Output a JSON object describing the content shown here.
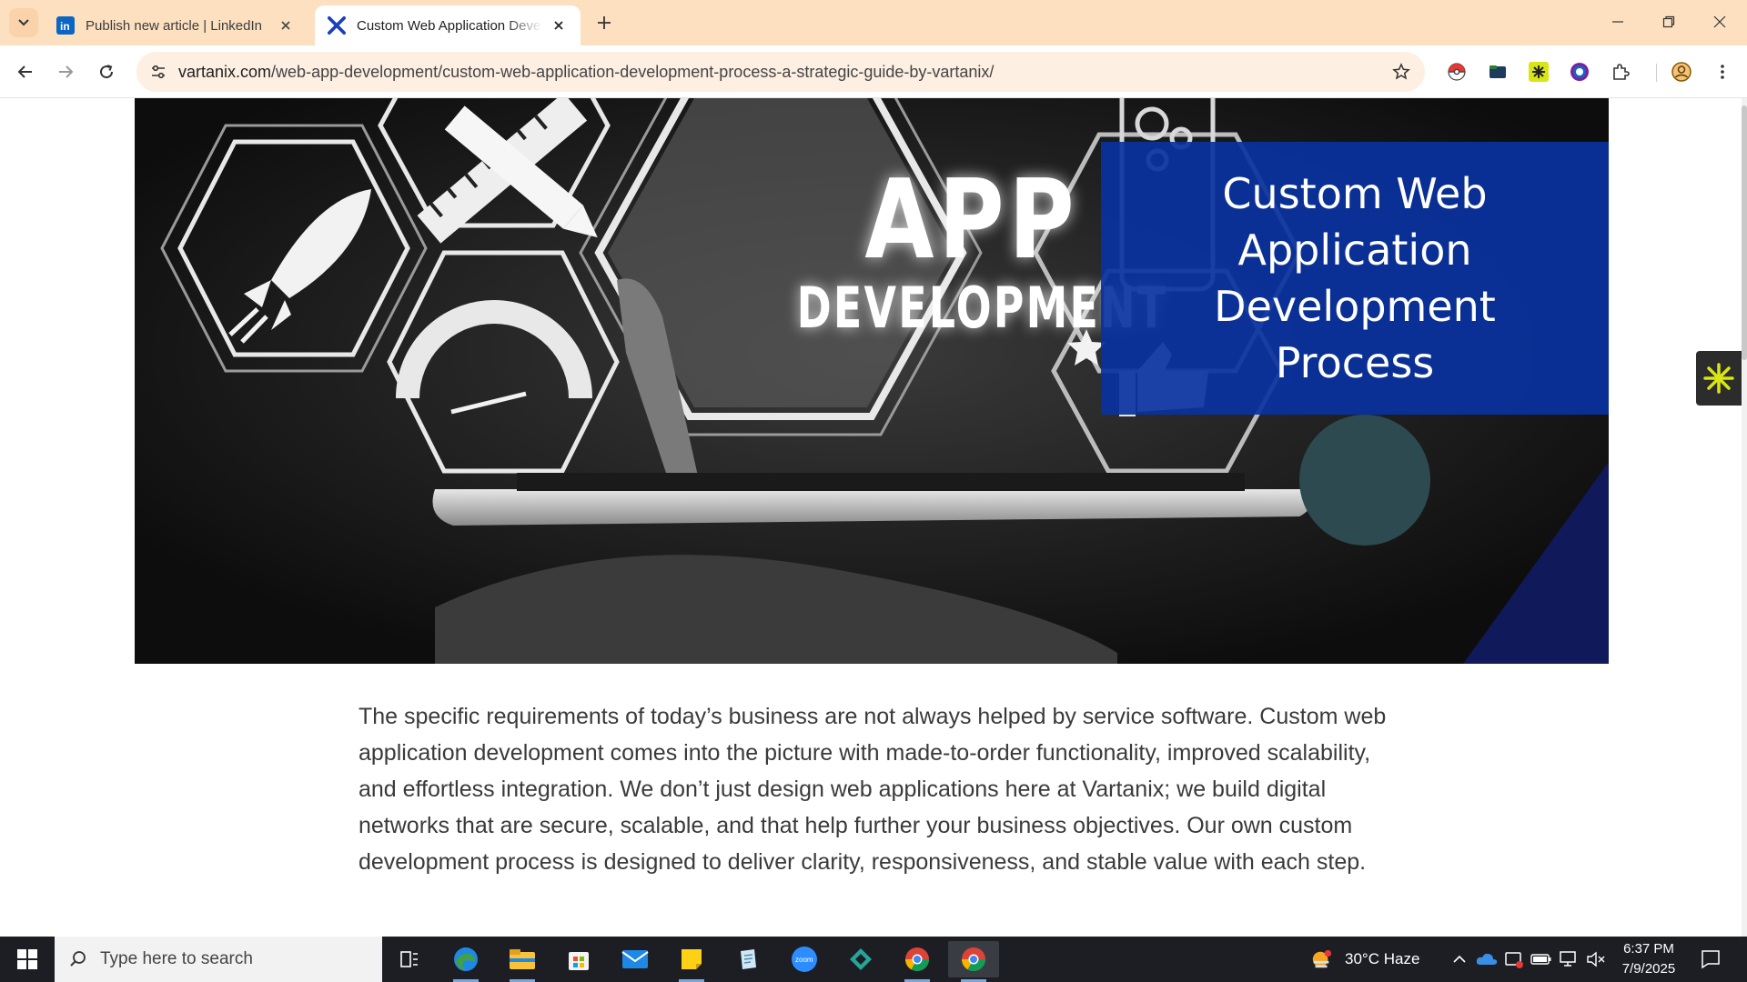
{
  "browser": {
    "tabs": [
      {
        "title": "Publish new article | LinkedIn",
        "favicon": "linkedin-icon",
        "active": false
      },
      {
        "title": "Custom Web Application Development Process",
        "favicon": "vartanix-icon",
        "active": true
      }
    ],
    "url_host": "vartanix.com",
    "url_path": "/web-app-development/custom-web-application-development-process-a-strategic-guide-by-vartanix/"
  },
  "hero": {
    "headline_line1": "APP",
    "headline_line2": "DEVELOPMENT",
    "panel_text": "Custom Web Application Development Process"
  },
  "article": {
    "paragraph": "The specific requirements of today’s business are not always helped by service software. Custom web application development comes into the picture with made-to-order functionality, improved scalability, and effortless integration. We don’t just design web applications here at Vartanix; we build digital networks that are secure, scalable, and that help further your business objectives. Our own custom development process is designed to deliver clarity, responsiveness, and stable value with each step."
  },
  "taskbar": {
    "search_placeholder": "Type here to search",
    "weather": "30°C  Haze",
    "time": "6:37 PM",
    "date": "7/9/2025"
  },
  "colors": {
    "tabstrip": "#fde0c0",
    "omnibox": "#fdefe2",
    "hero_panel": "#0a32a0",
    "taskbar": "#1c1e24"
  }
}
